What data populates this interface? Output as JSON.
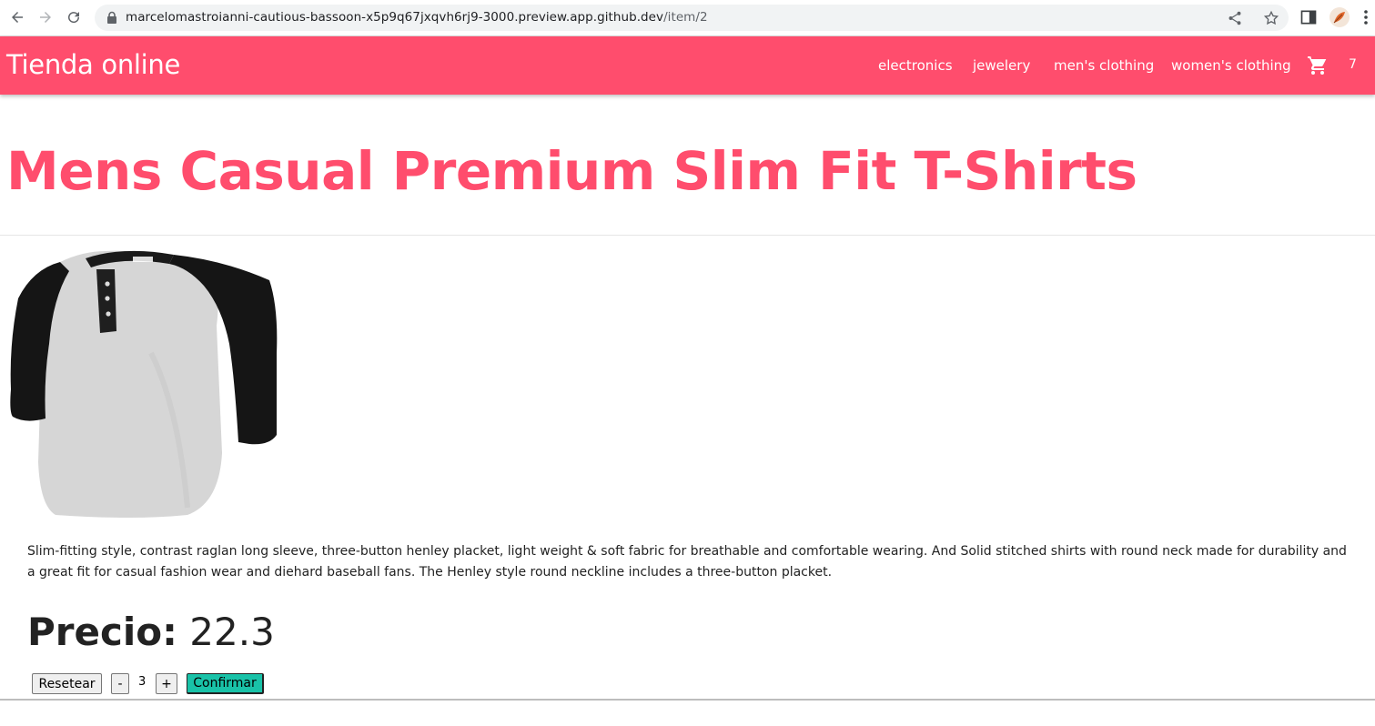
{
  "browser": {
    "url_host": "marcelomastroianni-cautious-bassoon-x5p9q67jxqvh6rj9-3000.preview.app.github.dev",
    "url_path": "/item/2"
  },
  "header": {
    "brand": "Tienda online",
    "menu": [
      "electronics",
      "jewelery",
      "men's clothing",
      "women's clothing"
    ],
    "cart_count": "7",
    "accent_color": "#ff4d6d"
  },
  "product": {
    "title": "Mens Casual Premium Slim Fit T-Shirts",
    "description": "Slim-fitting style, contrast raglan long sleeve, three-button henley placket, light weight & soft fabric for breathable and comfortable wearing. And Solid stitched shirts with round neck made for durability and a great fit for casual fashion wear and diehard baseball fans. The Henley style round neckline includes a three-button placket.",
    "price_label": "Precio:",
    "price_value": "22.3"
  },
  "controls": {
    "reset_label": "Resetear",
    "minus_label": "-",
    "quantity": "3",
    "plus_label": "+",
    "confirm_label": "Confirmar",
    "confirm_color": "#19c2a8"
  }
}
